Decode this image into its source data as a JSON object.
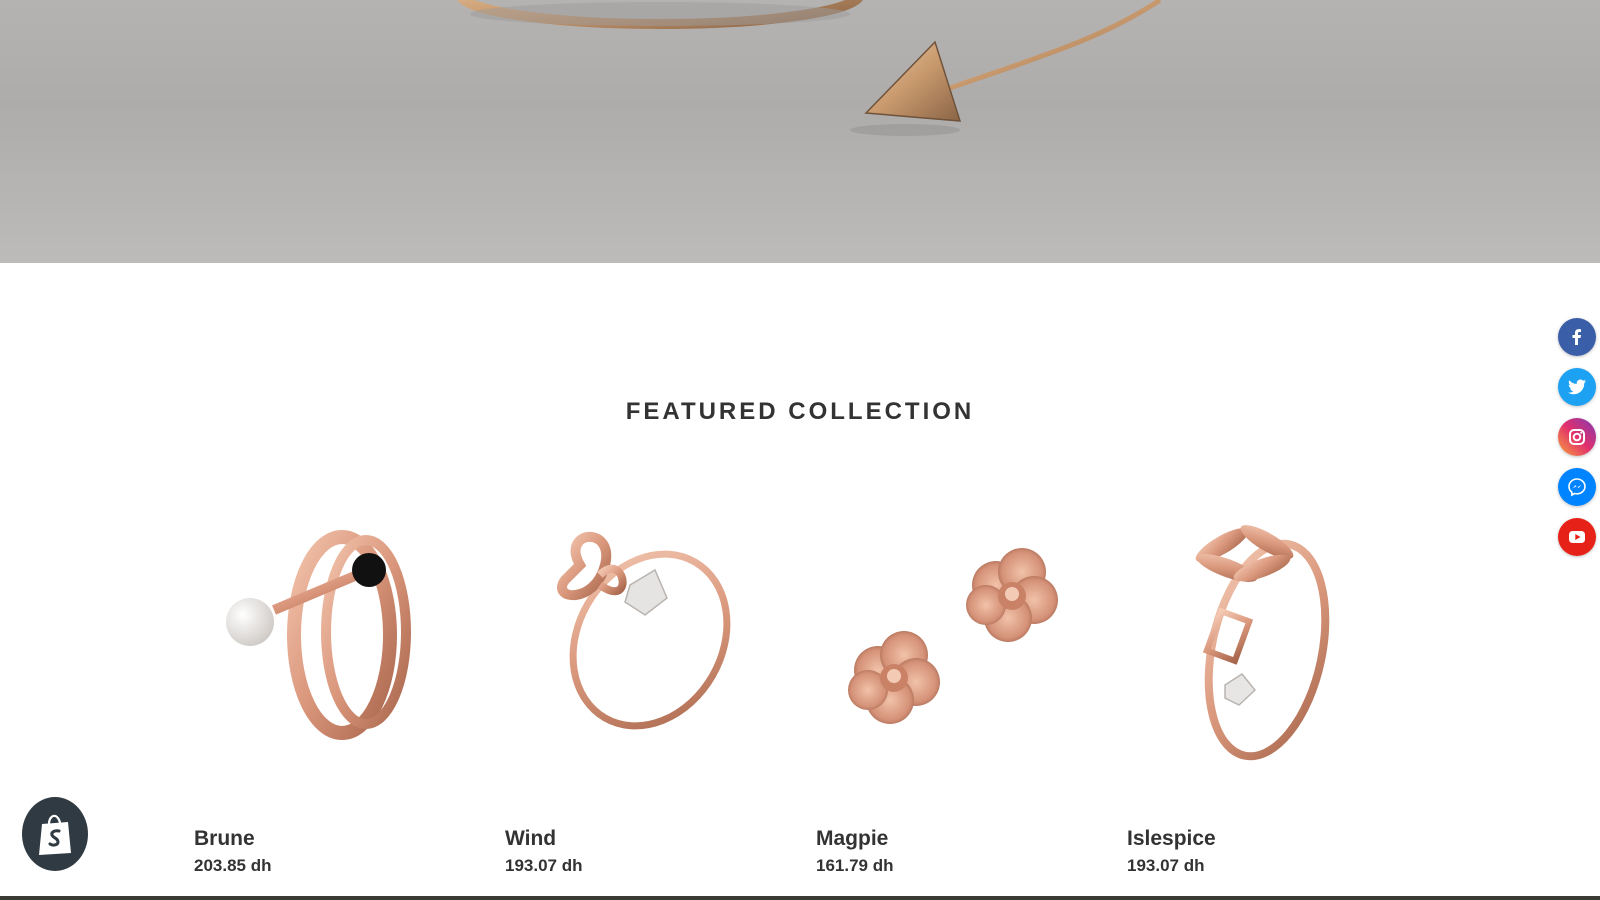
{
  "section": {
    "title": "FEATURED COLLECTION"
  },
  "products": [
    {
      "name": "Brune",
      "price": "203.85 dh"
    },
    {
      "name": "Wind",
      "price": "193.07 dh"
    },
    {
      "name": "Magpie",
      "price": "161.79 dh"
    },
    {
      "name": "Islespice",
      "price": "193.07 dh"
    }
  ],
  "social": [
    {
      "icon": "facebook-icon",
      "color": "#3b5ea8"
    },
    {
      "icon": "twitter-icon",
      "color": "#1da1f2"
    },
    {
      "icon": "instagram-icon",
      "color": "#c13584"
    },
    {
      "icon": "messenger-icon",
      "color": "#0084ff"
    },
    {
      "icon": "youtube-icon",
      "color": "#e62117"
    }
  ],
  "colors": {
    "rose_gold": "#d9957a",
    "text": "#333333"
  }
}
